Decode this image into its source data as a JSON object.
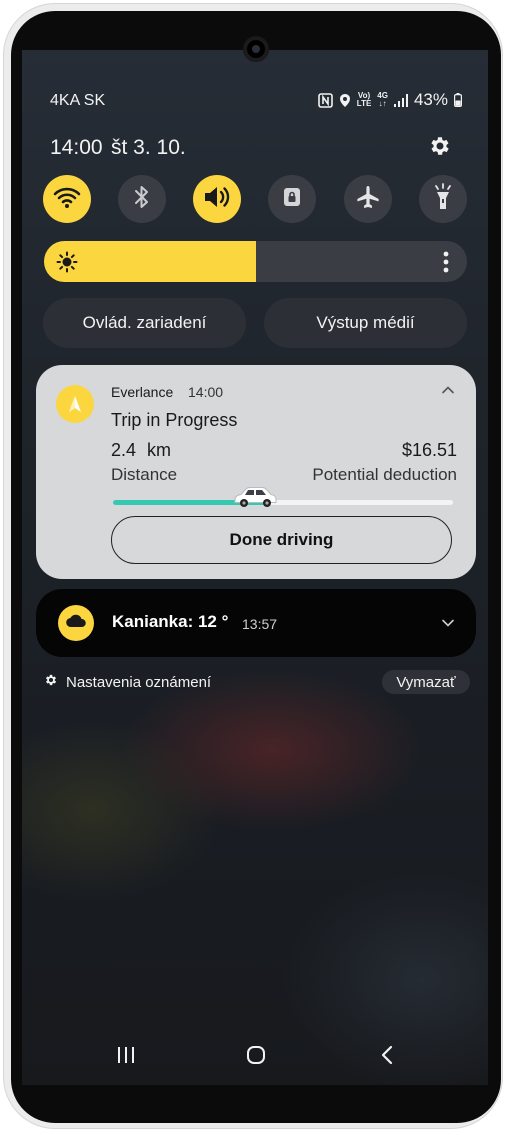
{
  "status_bar": {
    "carrier": "4KA SK",
    "volte_top": "Vo)",
    "volte_bottom": "LTE",
    "network_top": "4G",
    "network_bottom": "↓↑",
    "battery": "43%"
  },
  "header": {
    "time": "14:00",
    "date": "št 3. 10.",
    "settings_icon": "gear-icon"
  },
  "quick_settings": [
    {
      "name": "wifi",
      "icon": "wifi-icon",
      "active": true
    },
    {
      "name": "bluetooth",
      "icon": "bluetooth-icon",
      "active": false
    },
    {
      "name": "sound",
      "icon": "speaker-icon",
      "active": true
    },
    {
      "name": "rotation-lock",
      "icon": "lock-icon",
      "active": false
    },
    {
      "name": "airplane-mode",
      "icon": "airplane-icon",
      "active": false
    },
    {
      "name": "flashlight",
      "icon": "flashlight-icon",
      "active": false
    }
  ],
  "brightness": {
    "level": 0.5
  },
  "buttons": {
    "device_control": "Ovlád. zariadení",
    "media_output": "Výstup médií"
  },
  "everlance": {
    "app": "Everlance",
    "time": "14:00",
    "title": "Trip in Progress",
    "distance_value": "2.4",
    "distance_unit": "km",
    "deduction": "$16.51",
    "distance_label": "Distance",
    "deduction_label": "Potential deduction",
    "progress": 0.46,
    "action": "Done driving"
  },
  "weather": {
    "location": "Kanianka: 12 °",
    "time": "13:57"
  },
  "footer": {
    "settings_link": "Nastavenia oznámení",
    "clear": "Vymazať"
  },
  "colors": {
    "accent": "#fbd63f",
    "progress": "#35c9b4",
    "card": "#d7d8da"
  }
}
